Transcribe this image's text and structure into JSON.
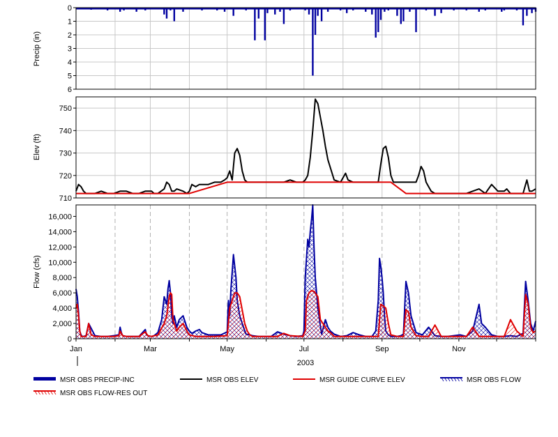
{
  "chart_data": [
    {
      "type": "bar",
      "ylabel": "Precip (in)",
      "ylim": [
        0,
        6
      ],
      "y_inverted": true,
      "yticks": [
        "0",
        "1",
        "2",
        "3",
        "4",
        "5",
        "6"
      ],
      "grid": true,
      "series": [
        {
          "name": "MSR OBS PRECIP-INC",
          "color": "#0000a0",
          "x": [
            5,
            12,
            25,
            30,
            35,
            38,
            45,
            48,
            55,
            60,
            70,
            72,
            75,
            78,
            85,
            95,
            100,
            110,
            112,
            118,
            125,
            135,
            140,
            142,
            145,
            150,
            152,
            158,
            162,
            165,
            170,
            175,
            182,
            185,
            188,
            190,
            192,
            195,
            200,
            210,
            215,
            220,
            225,
            230,
            235,
            238,
            240,
            242,
            245,
            248,
            255,
            258,
            260,
            265,
            270,
            278,
            285,
            290,
            295,
            300,
            305,
            310,
            315,
            320,
            325,
            330,
            338,
            340,
            345,
            350,
            355,
            358,
            362,
            365
          ],
          "values": [
            0.1,
            0.15,
            0.2,
            0.1,
            0.3,
            0.2,
            0.1,
            0.3,
            0.2,
            0.1,
            0.5,
            0.8,
            0.2,
            1.0,
            0.3,
            0.1,
            0.2,
            0.1,
            0.2,
            0.3,
            0.6,
            0.2,
            0.1,
            2.4,
            0.8,
            2.4,
            0.4,
            0.5,
            0.3,
            1.2,
            0.2,
            0.1,
            0.2,
            0.5,
            5.0,
            2.0,
            0.6,
            1.0,
            0.3,
            0.2,
            0.4,
            0.2,
            0.1,
            0.3,
            0.5,
            2.2,
            1.8,
            0.9,
            0.3,
            0.2,
            0.6,
            1.2,
            1.0,
            0.3,
            1.8,
            0.2,
            0.6,
            0.4,
            0.1,
            0.2,
            0.1,
            0.2,
            0.1,
            0.3,
            0.2,
            0.1,
            0.3,
            0.2,
            0.1,
            0.2,
            1.3,
            0.6,
            0.4,
            0.3
          ]
        }
      ]
    },
    {
      "type": "line",
      "ylabel": "Elev (ft)",
      "ylim": [
        710,
        755
      ],
      "yticks": [
        "710",
        "720",
        "730",
        "740",
        "750"
      ],
      "grid": true,
      "series": [
        {
          "name": "MSR OBS ELEV",
          "color": "#000000",
          "x": [
            0,
            2,
            4,
            6,
            8,
            12,
            15,
            20,
            25,
            30,
            35,
            40,
            45,
            50,
            55,
            60,
            62,
            65,
            70,
            72,
            74,
            76,
            78,
            80,
            85,
            88,
            90,
            92,
            95,
            98,
            100,
            105,
            110,
            115,
            118,
            120,
            122,
            124,
            126,
            128,
            130,
            132,
            134,
            136,
            138,
            140,
            145,
            150,
            155,
            160,
            165,
            170,
            175,
            180,
            182,
            184,
            186,
            188,
            190,
            192,
            194,
            196,
            198,
            200,
            205,
            210,
            212,
            214,
            216,
            220,
            225,
            230,
            235,
            240,
            242,
            244,
            246,
            248,
            250,
            252,
            255,
            260,
            265,
            270,
            272,
            274,
            276,
            278,
            280,
            282,
            285,
            290,
            295,
            300,
            305,
            310,
            315,
            320,
            325,
            330,
            335,
            340,
            342,
            345,
            350,
            355,
            358,
            360,
            362,
            365
          ],
          "values": [
            713,
            716,
            715,
            713,
            712,
            712,
            712,
            713,
            712,
            712,
            713,
            713,
            712,
            712,
            713,
            713,
            712,
            712,
            714,
            717,
            716,
            713,
            713,
            714,
            713,
            712,
            713,
            716,
            715,
            716,
            716,
            716,
            717,
            717,
            718,
            719,
            722,
            718,
            730,
            732,
            729,
            722,
            718,
            717,
            717,
            717,
            717,
            717,
            717,
            717,
            717,
            718,
            717,
            717,
            718,
            720,
            728,
            740,
            754,
            752,
            746,
            740,
            733,
            727,
            718,
            717,
            719,
            721,
            718,
            717,
            717,
            717,
            717,
            717,
            725,
            732,
            733,
            728,
            720,
            717,
            717,
            717,
            717,
            717,
            720,
            724,
            722,
            717,
            715,
            713,
            712,
            712,
            712,
            712,
            712,
            712,
            713,
            714,
            712,
            716,
            713,
            713,
            714,
            712,
            712,
            712,
            718,
            713,
            713,
            714
          ]
        },
        {
          "name": "MSR GUIDE CURVE ELEV",
          "color": "#e00000",
          "x": [
            0,
            90,
            120,
            250,
            262,
            365
          ],
          "values": [
            712,
            712,
            717,
            717,
            712,
            712
          ]
        }
      ]
    },
    {
      "type": "area",
      "ylabel": "Flow (cfs)",
      "xlabel": "2003",
      "ylim": [
        0,
        17500
      ],
      "yticks": [
        "0",
        "2,000",
        "4,000",
        "6,000",
        "8,000",
        "10,000",
        "12,000",
        "14,000",
        "16,000"
      ],
      "xticks": [
        "Jan",
        "Mar",
        "May",
        "Jul",
        "Sep",
        "Nov"
      ],
      "xtick_days": [
        0,
        59,
        120,
        181,
        243,
        304
      ],
      "month_days": [
        0,
        31,
        59,
        90,
        120,
        151,
        181,
        212,
        243,
        273,
        304,
        334,
        365
      ],
      "grid": true,
      "series": [
        {
          "name": "MSR OBS FLOW",
          "color": "#0000a0",
          "hatch": "cross",
          "x": [
            0,
            1,
            2,
            3,
            4,
            5,
            6,
            8,
            10,
            15,
            20,
            25,
            30,
            34,
            35,
            36,
            37,
            40,
            45,
            50,
            55,
            55,
            56,
            57,
            60,
            62,
            65,
            68,
            70,
            72,
            73,
            74,
            75,
            76,
            77,
            78,
            80,
            82,
            85,
            88,
            90,
            92,
            95,
            98,
            100,
            105,
            110,
            115,
            120,
            121,
            122,
            123,
            125,
            127,
            128,
            130,
            132,
            133,
            135,
            138,
            140,
            145,
            150,
            155,
            160,
            165,
            170,
            175,
            180,
            181,
            182,
            183,
            184,
            185,
            186,
            187,
            188,
            189,
            190,
            192,
            195,
            198,
            200,
            202,
            205,
            210,
            215,
            220,
            225,
            230,
            235,
            238,
            240,
            241,
            242,
            243,
            244,
            245,
            246,
            248,
            250,
            255,
            258,
            260,
            262,
            264,
            266,
            270,
            275,
            280,
            285,
            290,
            295,
            300,
            305,
            310,
            315,
            320,
            322,
            325,
            330,
            335,
            340,
            345,
            350,
            355,
            357,
            359,
            361,
            363,
            365
          ],
          "values": [
            6500,
            5500,
            3500,
            1000,
            500,
            300,
            300,
            400,
            2000,
            400,
            300,
            300,
            400,
            500,
            1500,
            800,
            400,
            300,
            300,
            300,
            1200,
            1200,
            500,
            400,
            300,
            400,
            800,
            2500,
            5500,
            4500,
            6500,
            7600,
            6000,
            3000,
            2000,
            3000,
            1500,
            2500,
            3000,
            1500,
            1000,
            700,
            1000,
            1200,
            800,
            500,
            500,
            500,
            900,
            5000,
            3000,
            6500,
            11000,
            8000,
            5000,
            3000,
            2000,
            1500,
            600,
            500,
            400,
            300,
            300,
            300,
            900,
            600,
            400,
            300,
            400,
            1000,
            8000,
            10500,
            13000,
            12000,
            14000,
            15500,
            17500,
            12000,
            8000,
            4000,
            600,
            2500,
            1500,
            1000,
            600,
            300,
            400,
            800,
            500,
            300,
            300,
            1000,
            5000,
            10500,
            9500,
            8000,
            6000,
            3000,
            1000,
            500,
            300,
            300,
            400,
            600,
            7500,
            6000,
            3000,
            800,
            500,
            1500,
            400,
            300,
            300,
            400,
            500,
            300,
            1000,
            4500,
            2000,
            1500,
            500,
            300,
            300,
            400,
            300,
            700,
            7500,
            5000,
            2000,
            1000,
            2300
          ]
        },
        {
          "name": "MSR OBS FLOW-RES OUT",
          "color": "#e00000",
          "hatch": "diag",
          "x": [
            0,
            1,
            2,
            3,
            4,
            5,
            8,
            10,
            12,
            15,
            20,
            30,
            34,
            35,
            37,
            40,
            50,
            55,
            57,
            60,
            65,
            70,
            72,
            74,
            75,
            76,
            77,
            78,
            80,
            82,
            85,
            88,
            90,
            95,
            100,
            110,
            120,
            122,
            124,
            126,
            128,
            130,
            134,
            136,
            138,
            140,
            150,
            160,
            165,
            170,
            180,
            182,
            183,
            185,
            187,
            189,
            190,
            192,
            194,
            196,
            198,
            200,
            202,
            205,
            210,
            215,
            225,
            235,
            240,
            242,
            244,
            246,
            248,
            250,
            255,
            258,
            260,
            262,
            264,
            266,
            270,
            275,
            280,
            285,
            290,
            295,
            300,
            305,
            310,
            315,
            320,
            322,
            325,
            330,
            340,
            345,
            350,
            355,
            357,
            359,
            361,
            363,
            365
          ],
          "values": [
            4000,
            4500,
            3000,
            1000,
            300,
            300,
            300,
            2000,
            500,
            300,
            300,
            300,
            400,
            1000,
            400,
            300,
            300,
            900,
            400,
            300,
            500,
            2000,
            3000,
            5500,
            6000,
            5800,
            2500,
            2000,
            1000,
            1500,
            2000,
            1000,
            500,
            300,
            300,
            300,
            400,
            4000,
            5000,
            6000,
            6000,
            5500,
            2000,
            1000,
            500,
            300,
            300,
            300,
            700,
            400,
            300,
            1000,
            5000,
            6000,
            6300,
            6200,
            6000,
            5500,
            2500,
            2000,
            1500,
            1000,
            800,
            300,
            300,
            300,
            300,
            300,
            300,
            4500,
            4300,
            4000,
            2000,
            500,
            300,
            300,
            300,
            3800,
            3500,
            1500,
            400,
            300,
            300,
            1800,
            300,
            300,
            300,
            300,
            300,
            1500,
            300,
            300,
            300,
            300,
            300,
            2500,
            1000,
            300,
            5800,
            4500,
            1500,
            800,
            1000
          ]
        }
      ]
    }
  ],
  "legend": [
    {
      "label": "MSR OBS PRECIP-INC",
      "style": "thick",
      "color": "#0000a0"
    },
    {
      "label": "MSR OBS ELEV",
      "style": "line",
      "color": "#000000"
    },
    {
      "label": "MSR GUIDE CURVE ELEV",
      "style": "line",
      "color": "#e00000"
    },
    {
      "label": "MSR OBS FLOW",
      "style": "hatch",
      "color": "#0000a0"
    },
    {
      "label": "MSR OBS FLOW-RES OUT",
      "style": "hatch",
      "color": "#e00000"
    }
  ]
}
